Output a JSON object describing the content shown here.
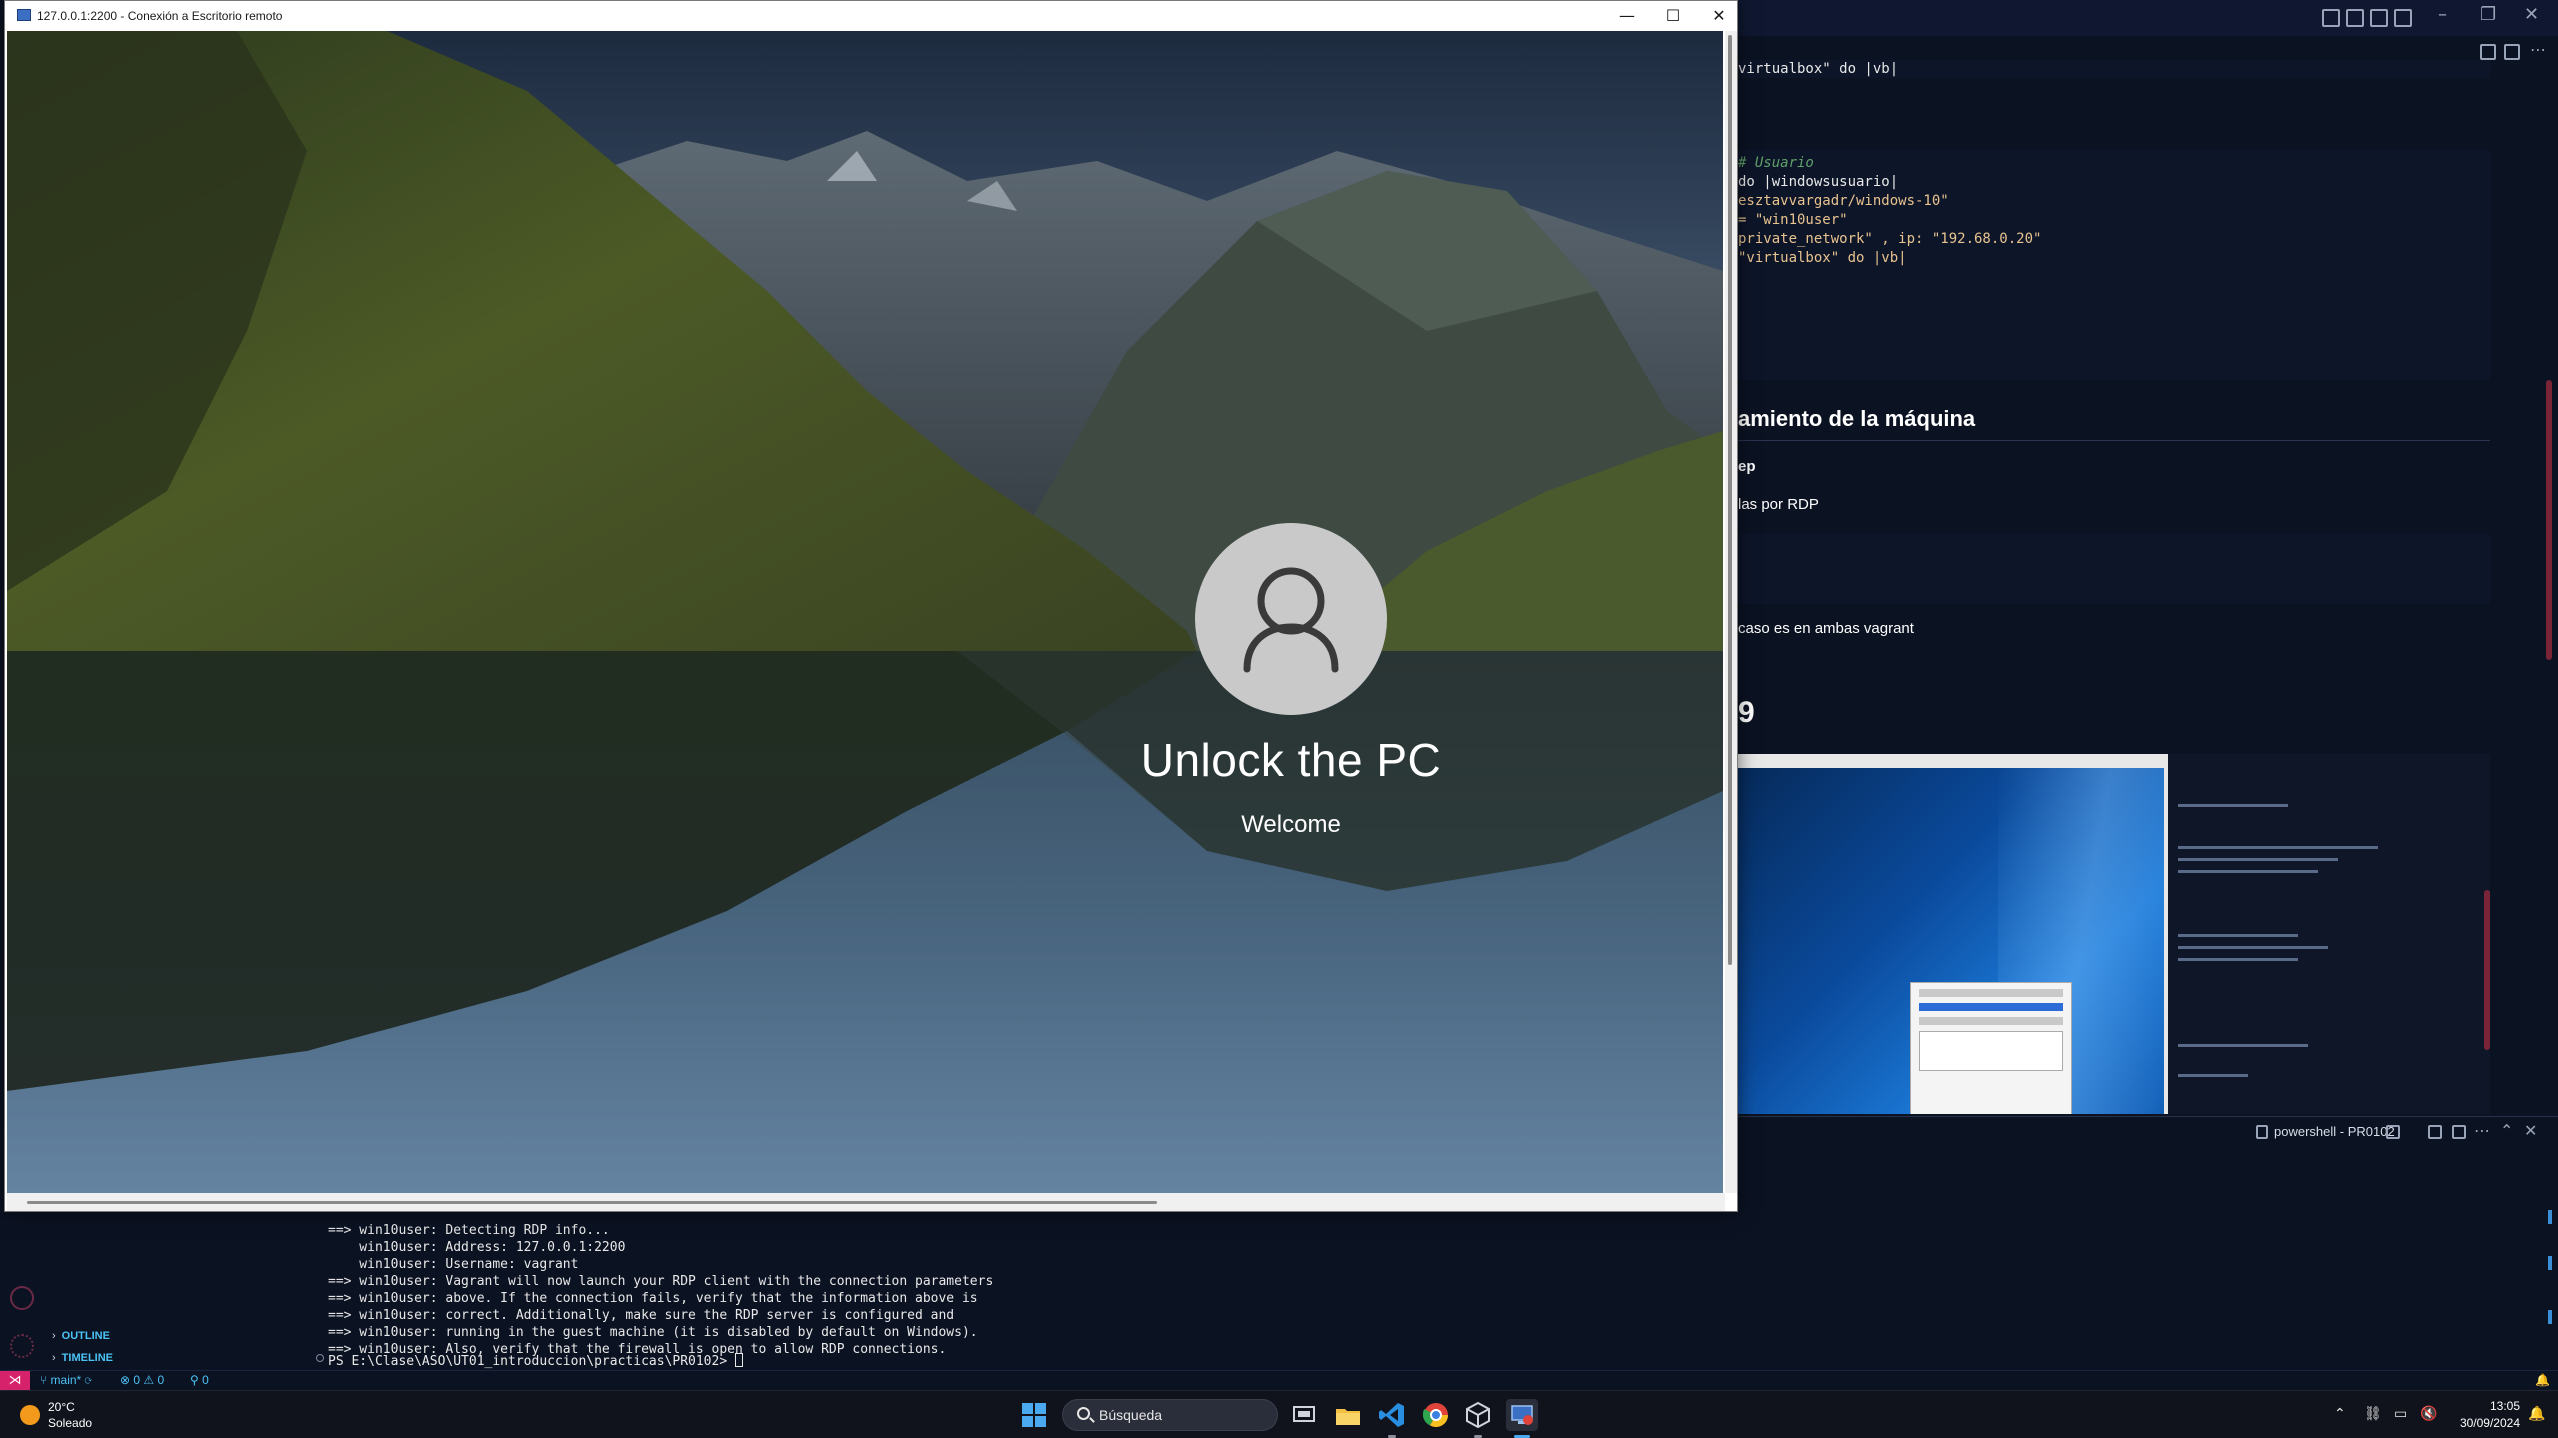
{
  "rdp": {
    "title": "127.0.0.1:2200 - Conexión a Escritorio remoto",
    "minimize": "—",
    "maximize": "☐",
    "close": "✕",
    "lock_title": "Unlock the PC",
    "lock_subtitle": "Welcome"
  },
  "editor": {
    "code_top": "virtualbox\" do |vb|",
    "code_lines": [
      "# Usuario",
      "do |windowsusuario|",
      "esztavvargadr/windows-10\"",
      "= \"win10user\"",
      "private_network\" , ip: \"192.68.0.20\"",
      "\"virtualbox\" do |vb|"
    ],
    "heading": "amiento de la máquina",
    "bold_text": "ep",
    "p1": "las por RDP",
    "p2": "caso es en ambas vagrant",
    "big_number": "9"
  },
  "terminal": {
    "panel_label": "powershell - PR0102",
    "lines": [
      "==> win10user: Detecting RDP info...",
      "    win10user: Address: 127.0.0.1:2200",
      "    win10user: Username: vagrant",
      "==> win10user: Vagrant will now launch your RDP client with the connection parameters",
      "==> win10user: above. If the connection fails, verify that the information above is",
      "==> win10user: correct. Additionally, make sure the RDP server is configured and",
      "==> win10user: running in the guest machine (it is disabled by default on Windows).",
      "==> win10user: Also, verify that the firewall is open to allow RDP connections."
    ],
    "prompt": "PS E:\\Clase\\ASO\\UT01_introduccion\\practicas\\PR0102> "
  },
  "sidebar": {
    "outline": "OUTLINE",
    "timeline": "TIMELINE"
  },
  "statusbar": {
    "branch": "main*",
    "problems": "⊗ 0 ⚠ 0",
    "ports": "⚲ 0"
  },
  "taskbar": {
    "temperature": "20°C",
    "weather": "Soleado",
    "search_placeholder": "Búsqueda",
    "time": "13:05",
    "date": "30/09/2024"
  },
  "colors": {
    "remote_indicator": "#d6226b",
    "accent": "#4aa9f0",
    "status_text": "#4cc3f5"
  }
}
